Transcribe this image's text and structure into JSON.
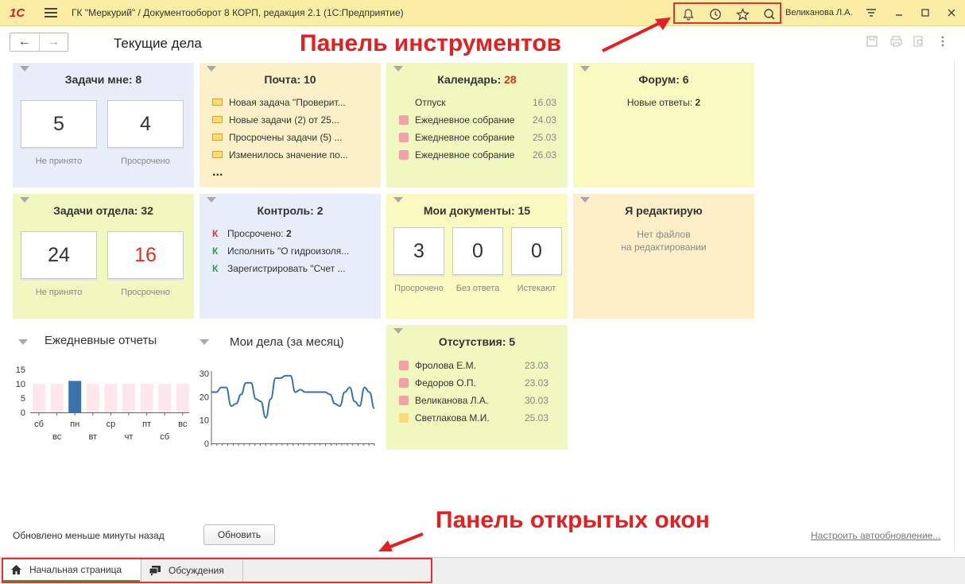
{
  "titlebar": {
    "logo": "1С",
    "title": "ГК \"Меркурий\" / Документооборот 8 КОРП, редакция 2.1  (1С:Предприятие)",
    "user": "Великанова Л.А.",
    "tools": [
      "bell-icon",
      "history-icon",
      "star-icon",
      "search-icon"
    ]
  },
  "page": {
    "title": "Текущие дела"
  },
  "annotations": {
    "toolbar": "Панель инструментов",
    "openwindows": "Панель открытых окон"
  },
  "widgets": {
    "tasks_me": {
      "title": "Задачи мне: 8",
      "cards": [
        {
          "value": "5",
          "label": "Не принято"
        },
        {
          "value": "4",
          "label": "Просрочено"
        }
      ]
    },
    "mail": {
      "title": "Почта: 10",
      "items": [
        "Новая задача \"Проверит...",
        "Новые задачи (2) от 25...",
        "Просрочены задачи (5) ...",
        "Изменилось значение по..."
      ],
      "more": "..."
    },
    "calendar": {
      "title_label": "Календарь: ",
      "title_count": "28",
      "items": [
        {
          "name": "Отпуск",
          "date": "16.03",
          "color": ""
        },
        {
          "name": "Ежедневное собрание",
          "date": "24.03",
          "color": "#f4a0a8"
        },
        {
          "name": "Ежедневное собрание",
          "date": "25.03",
          "color": "#f4a0a8"
        },
        {
          "name": "Ежедневное собрание",
          "date": "26.03",
          "color": "#f4a0a8"
        }
      ]
    },
    "forum": {
      "title": "Форум: 6",
      "text": "Новые ответы: ",
      "count": "2"
    },
    "dept_tasks": {
      "title": "Задачи отдела: 32",
      "cards": [
        {
          "value": "24",
          "label": "Не принято"
        },
        {
          "value": "16",
          "label": "Просрочено"
        }
      ]
    },
    "control": {
      "title": "Контроль: 2",
      "items": [
        {
          "mark": "К",
          "text": "Просрочено: ",
          "bold": "2",
          "color": "#d9382c"
        },
        {
          "mark": "К",
          "text": "Исполнить \"О гидроизоля...",
          "bold": "",
          "color": "#2e9a4a"
        },
        {
          "mark": "К",
          "text": "Зарегистрировать \"Счет ...",
          "bold": "",
          "color": "#2e9a4a"
        }
      ]
    },
    "my_docs": {
      "title": "Мои документы: 15",
      "cards": [
        {
          "value": "3",
          "label": "Просрочено"
        },
        {
          "value": "0",
          "label": "Без ответа"
        },
        {
          "value": "0",
          "label": "Истекают"
        }
      ]
    },
    "editing": {
      "title": "Я редактирую",
      "line1": "Нет файлов",
      "line2": "на редактировании"
    },
    "daily_reports": {
      "title": "Ежедневные отчеты"
    },
    "my_affairs": {
      "title": "Мои дела (за месяц)"
    },
    "absences": {
      "title": "Отсутствия: 5",
      "items": [
        {
          "name": "Фролова Е.М.",
          "date": "23.03",
          "color": "#f4a0a8"
        },
        {
          "name": "Федоров О.П.",
          "date": "23.03",
          "color": "#f4a0a8"
        },
        {
          "name": "Великанова Л.А.",
          "date": "30.03",
          "color": "#f4a0a8"
        },
        {
          "name": "Светлакова М.И.",
          "date": "25.03",
          "color": "#fcd97a"
        }
      ]
    }
  },
  "chart_data": [
    {
      "type": "bar",
      "categories": [
        "сб",
        "вс",
        "пн",
        "вт",
        "ср",
        "чт",
        "пт",
        "сб",
        "вс"
      ],
      "values": [
        10,
        10,
        11,
        10,
        10,
        10,
        10,
        10,
        10
      ],
      "highlight_index": 2,
      "colors": {
        "normal": "#fde6ec",
        "highlight": "#3a72b0"
      },
      "ylim": [
        0,
        15
      ],
      "yticks": [
        "0",
        "5",
        "10",
        "15"
      ]
    },
    {
      "type": "line",
      "values": [
        22,
        22,
        24,
        24,
        16,
        17,
        21,
        26,
        26,
        19,
        18,
        11,
        19,
        28,
        28,
        29,
        29,
        22,
        23,
        22,
        22,
        22,
        22,
        22,
        21,
        17,
        16,
        22,
        24,
        18,
        16,
        24,
        22,
        15
      ],
      "color": "#3a72b0",
      "ylim": [
        0,
        30
      ],
      "yticks": [
        "0",
        "10",
        "20",
        "30"
      ]
    }
  ],
  "footer": {
    "updated": "Обновлено меньше минуты назад",
    "refresh": "Обновить",
    "autoupdate": "Настроить автообновление..."
  },
  "tabs": [
    {
      "label": "Начальная страница",
      "icon": "home-icon"
    },
    {
      "label": "Обсуждения",
      "icon": "chat-icon"
    }
  ]
}
